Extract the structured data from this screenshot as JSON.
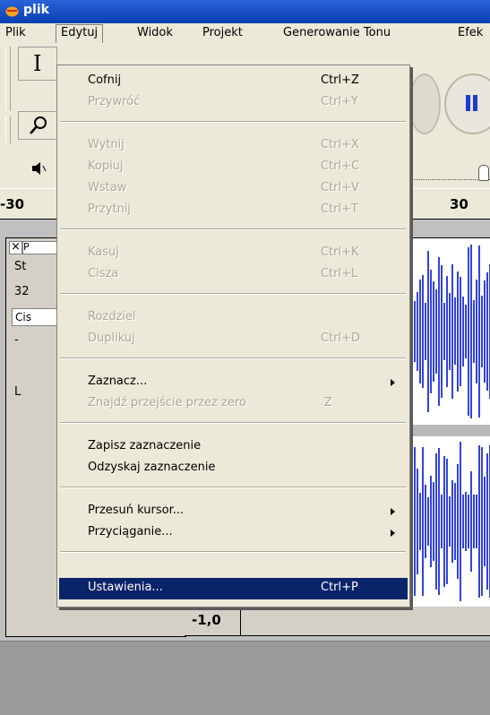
{
  "window": {
    "title": "plik"
  },
  "menubar": {
    "items": [
      "Plik",
      "Edytuj",
      "Widok",
      "Projekt",
      "Generowanie Tonu",
      "Efek"
    ]
  },
  "ruler": {
    "labels": [
      "-30",
      "30"
    ]
  },
  "track_panel": {
    "close": "×",
    "name_stub": "P",
    "info1": "St",
    "info2": "32",
    "button_stub": "Cis",
    "gain_stub": "-",
    "pan_stub": "L"
  },
  "bottom_value": "-1,0",
  "edit_menu": {
    "items": [
      {
        "label": "Cofnij",
        "shortcut": "Ctrl+Z",
        "enabled": true
      },
      {
        "label": "Przywróć",
        "shortcut": "Ctrl+Y",
        "enabled": false
      },
      {
        "label": "Wytnij",
        "shortcut": "Ctrl+X",
        "enabled": false
      },
      {
        "label": "Kopiuj",
        "shortcut": "Ctrl+C",
        "enabled": false
      },
      {
        "label": "Wstaw",
        "shortcut": "Ctrl+V",
        "enabled": false
      },
      {
        "label": "Przytnij",
        "shortcut": "Ctrl+T",
        "enabled": false
      },
      {
        "label": "Kasuj",
        "shortcut": "Ctrl+K",
        "enabled": false
      },
      {
        "label": "Cisza",
        "shortcut": "Ctrl+L",
        "enabled": false
      },
      {
        "label": "Rozdziel",
        "shortcut": "",
        "enabled": false
      },
      {
        "label": "Duplikuj",
        "shortcut": "Ctrl+D",
        "enabled": false
      },
      {
        "label": "Zaznacz...",
        "shortcut": "",
        "enabled": true,
        "submenu": true
      },
      {
        "label": "Znajdź przejście przez zero",
        "shortcut": "Z",
        "enabled": false
      },
      {
        "label": "Zapisz zaznaczenie",
        "shortcut": "",
        "enabled": true
      },
      {
        "label": "Odzyskaj zaznaczenie",
        "shortcut": "",
        "enabled": true
      },
      {
        "label": "Przesuń kursor...",
        "shortcut": "",
        "enabled": true,
        "submenu": true
      },
      {
        "label": "Przyciąganie...",
        "shortcut": "",
        "enabled": true,
        "submenu": true
      },
      {
        "label": "Ustawienia...",
        "shortcut": "Ctrl+P",
        "enabled": true,
        "highlighted": true
      }
    ]
  },
  "colors": {
    "titlebar": "#0b3fb0",
    "highlight": "#0a246a",
    "waveform": "#3243d6",
    "menu_bg": "#ece9d8"
  },
  "icons": [
    "audacity-app-icon",
    "ibeam-tool-icon",
    "zoom-tool-icon",
    "speaker-icon",
    "pause-icon",
    "submenu-arrow-icon"
  ]
}
